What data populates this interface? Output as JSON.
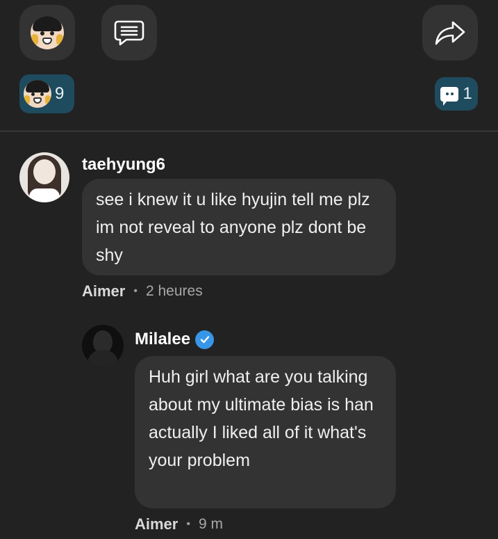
{
  "actions": {
    "reaction_icon": "emoji-reaction-icon",
    "comment_icon": "comment-icon",
    "share_icon": "share-arrow-icon"
  },
  "counters": {
    "reactions": "9",
    "comments": "1"
  },
  "colors": {
    "background": "#222222",
    "button_bg": "#333333",
    "counter_bg": "#1f4b5e",
    "bubble_bg": "#333333",
    "verified": "#3796e8"
  },
  "comments": [
    {
      "username": "taehyung6",
      "text": "see i knew it u like hyujin tell me plz im not reveal to anyone plz dont be shy",
      "like_label": "Aimer",
      "time": "2 heures"
    },
    {
      "username": "Milalee",
      "verified": true,
      "text": "Huh girl what are you talking about my ultimate bias is han actually I liked all of it what's your problem",
      "like_label": "Aimer",
      "time": "9 m"
    }
  ]
}
